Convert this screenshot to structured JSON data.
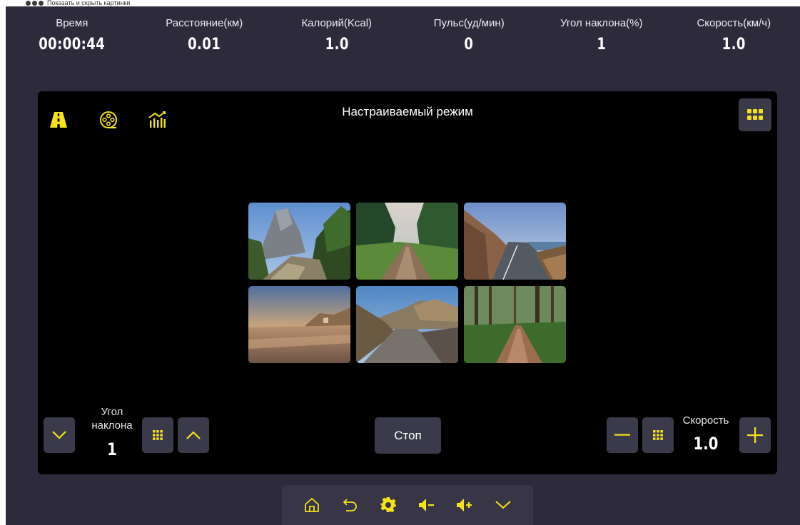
{
  "top_note": {
    "text": "Показать и скрыть картинки"
  },
  "stats": [
    {
      "label": "Время",
      "value": "00:00:44"
    },
    {
      "label": "Расстояние(км)",
      "value": "0.01"
    },
    {
      "label": "Калорий(Kcal)",
      "value": "1.0"
    },
    {
      "label": "Пульс(уд/мин)",
      "value": "0"
    },
    {
      "label": "Угол наклона(%)",
      "value": "1"
    },
    {
      "label": "Скорость(км/ч)",
      "value": "1.0"
    }
  ],
  "panel": {
    "title": "Настраиваемый режим",
    "mode_icons": [
      "road-icon",
      "film-reel-icon",
      "chart-icon"
    ],
    "grid_toggle_icon": "grid-icon",
    "scenes": [
      {
        "name": "mountain-trail"
      },
      {
        "name": "forest-dirt-road"
      },
      {
        "name": "coastal-road"
      },
      {
        "name": "beach-sunset"
      },
      {
        "name": "gravel-road-hills"
      },
      {
        "name": "forest-path"
      }
    ]
  },
  "incline": {
    "label": "Угол наклона",
    "value": "1"
  },
  "speed": {
    "label": "Скорость",
    "value": "1.0"
  },
  "stop_label": "Стоп",
  "bottom_bar": [
    "home-icon",
    "back-icon",
    "settings-icon",
    "volume-down-icon",
    "volume-up-icon",
    "collapse-icon"
  ],
  "colors": {
    "accent": "#f5e21b",
    "background": "#2d2a3c",
    "panel": "#000000",
    "button": "#3a3a4a"
  }
}
